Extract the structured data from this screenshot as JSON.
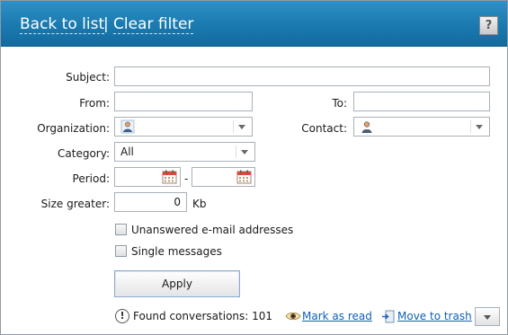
{
  "header": {
    "back_to_list": "Back to list",
    "separator": "|",
    "clear_filter": "Clear filter",
    "help_symbol": "?"
  },
  "form": {
    "subject": {
      "label": "Subject:",
      "value": ""
    },
    "from": {
      "label": "From:",
      "value": ""
    },
    "to": {
      "label": "To:",
      "value": ""
    },
    "organization": {
      "label": "Organization:",
      "value": "",
      "icon": "person-icon"
    },
    "contact": {
      "label": "Contact:",
      "value": "",
      "icon": "person-icon"
    },
    "category": {
      "label": "Category:",
      "value": "All"
    },
    "period": {
      "label": "Period:",
      "from": "",
      "separator": "-",
      "to": "",
      "icon": "calendar-icon"
    },
    "size_greater": {
      "label": "Size greater:",
      "value": "0",
      "unit": "Kb"
    },
    "unanswered": {
      "label": "Unanswered e-mail addresses",
      "checked": false
    },
    "single_messages": {
      "label": "Single messages",
      "checked": false
    },
    "apply_label": "Apply"
  },
  "footer": {
    "found_text": "Found conversations: 101",
    "mark_as_read": "Mark as read",
    "move_to_trash": "Move to trash"
  },
  "colors": {
    "header_blue": "#1a7ab0",
    "link_blue": "#1060b8"
  }
}
